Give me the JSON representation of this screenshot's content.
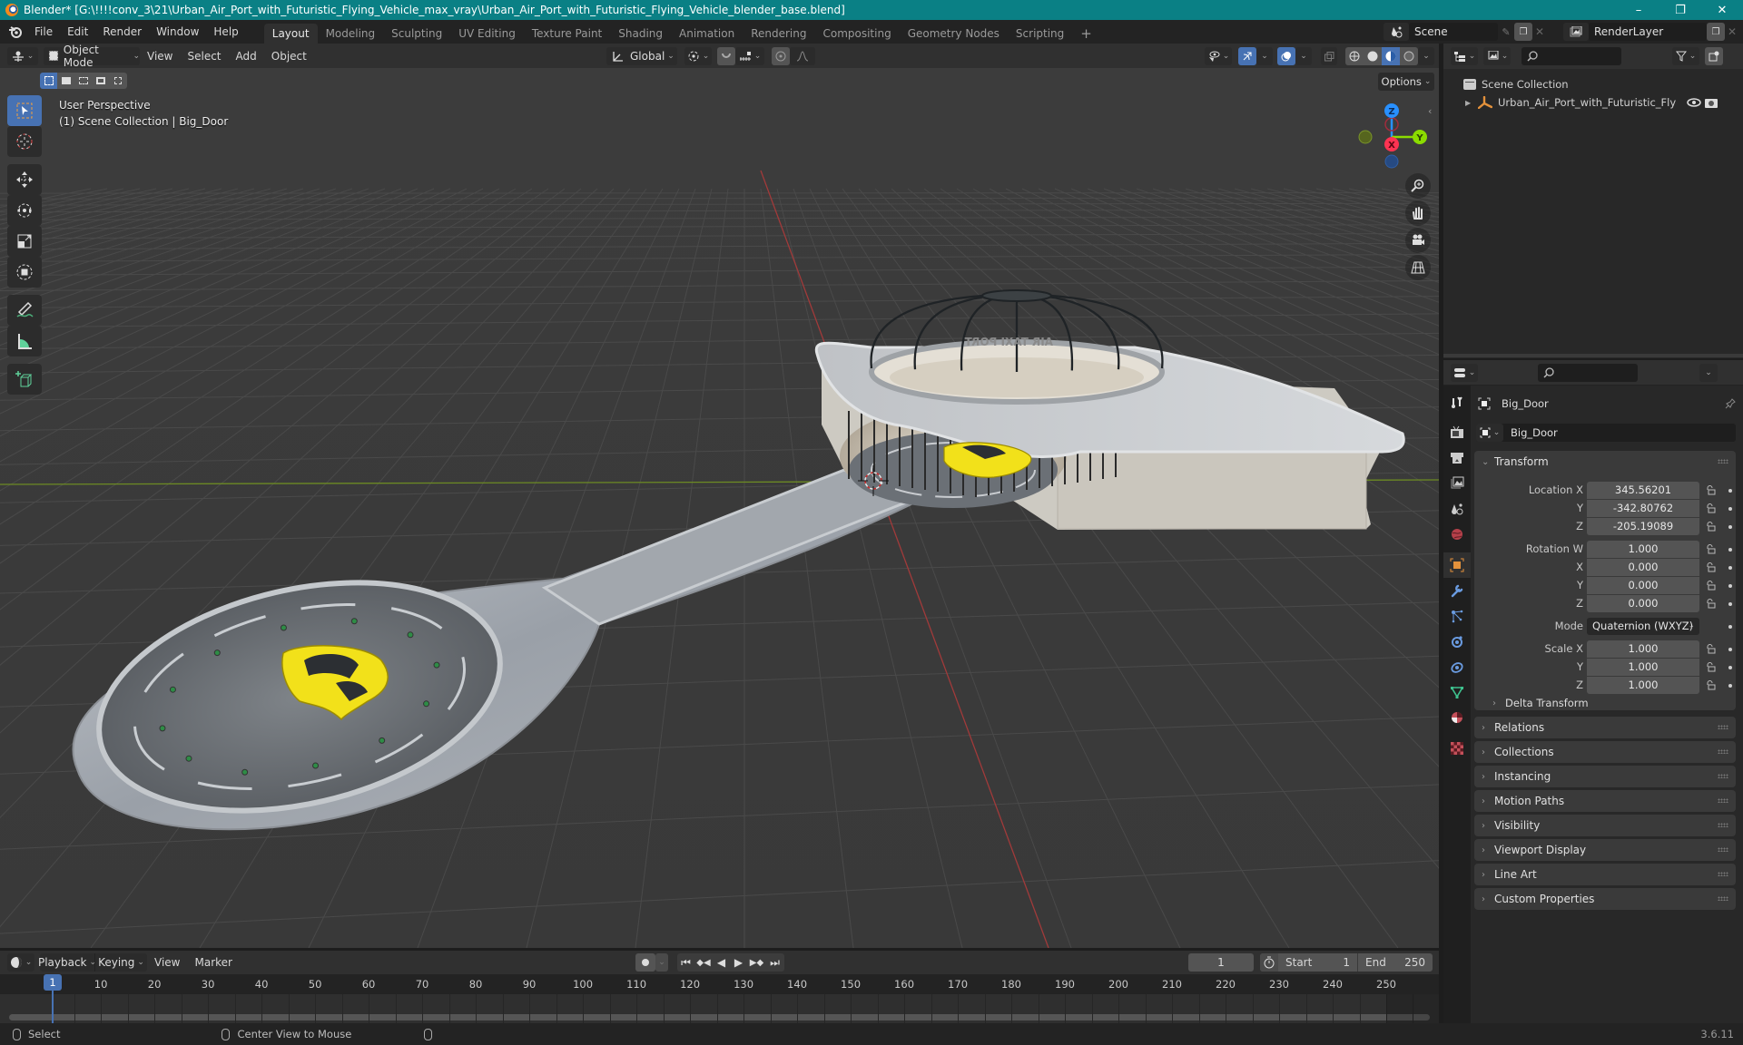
{
  "window": {
    "title": "Blender* [G:\\!!!!conv_3\\21\\Urban_Air_Port_with_Futuristic_Flying_Vehicle_max_vray\\Urban_Air_Port_with_Futuristic_Flying_Vehicle_blender_base.blend]",
    "minimize_glyph": "–",
    "maximize_glyph": "❐",
    "close_glyph": "✕"
  },
  "menu": {
    "items": [
      "File",
      "Edit",
      "Render",
      "Window",
      "Help"
    ]
  },
  "workspaces": {
    "tabs": [
      "Layout",
      "Modeling",
      "Sculpting",
      "UV Editing",
      "Texture Paint",
      "Shading",
      "Animation",
      "Rendering",
      "Compositing",
      "Geometry Nodes",
      "Scripting"
    ],
    "active": "Layout",
    "add_glyph": "+"
  },
  "scene_selector": {
    "value": "Scene"
  },
  "view_layer_selector": {
    "value": "RenderLayer"
  },
  "viewport_header": {
    "mode": "Object Mode",
    "menus": [
      "View",
      "Select",
      "Add",
      "Object"
    ],
    "transform_orientation": "Global",
    "options_label": "Options"
  },
  "viewport": {
    "perspective_label": "User Perspective",
    "context_label": "(1) Scene Collection | Big_Door",
    "sign_text": "AIR TAXI PORT",
    "gizmo": {
      "x": "X",
      "y": "Y",
      "z": "Z"
    },
    "colors": {
      "x_axis": "#ff3352",
      "y_axis": "#8bdc00",
      "z_axis": "#2890ff",
      "accent": "#4772b3",
      "vehicle": "#f2e11a"
    }
  },
  "toolbar": {
    "tools": [
      "select-box",
      "cursor",
      "move",
      "rotate",
      "scale",
      "transform",
      "annotate",
      "measure",
      "add-cube"
    ],
    "active": "select-box"
  },
  "outliner": {
    "root": "Scene Collection",
    "items": [
      {
        "label": "Urban_Air_Port_with_Futuristic_Flying_\\",
        "type": "empty"
      }
    ]
  },
  "properties": {
    "object_name": "Big_Door",
    "datablock_name": "Big_Door",
    "transform": {
      "title": "Transform",
      "location": {
        "label": "Location X",
        "x": "345.56201",
        "y": "-342.80762",
        "z": "-205.19089"
      },
      "rotation": {
        "label": "Rotation W",
        "w": "1.000",
        "x": "0.000",
        "y": "0.000",
        "z": "0.000"
      },
      "mode_label": "Mode",
      "mode_value": "Quaternion (WXYZ)",
      "scale": {
        "label": "Scale X",
        "x": "1.000",
        "y": "1.000",
        "z": "1.000"
      },
      "axis_labels": {
        "x": "X",
        "y": "Y",
        "z": "Z"
      },
      "delta": "Delta Transform"
    },
    "panels": [
      "Relations",
      "Collections",
      "Instancing",
      "Motion Paths",
      "Visibility",
      "Viewport Display",
      "Line Art",
      "Custom Properties"
    ]
  },
  "timeline": {
    "menus": [
      "Playback",
      "Keying",
      "View",
      "Marker"
    ],
    "current_frame": "1",
    "start_label": "Start",
    "start": "1",
    "end_label": "End",
    "end": "250",
    "ticks": [
      "10",
      "20",
      "30",
      "40",
      "50",
      "60",
      "70",
      "80",
      "90",
      "100",
      "110",
      "120",
      "130",
      "140",
      "150",
      "160",
      "170",
      "180",
      "190",
      "200",
      "210",
      "220",
      "230",
      "240",
      "250"
    ],
    "playhead_label": "1"
  },
  "statusbar": {
    "select": "Select",
    "center_view": "Center View to Mouse",
    "version": "3.6.11"
  }
}
